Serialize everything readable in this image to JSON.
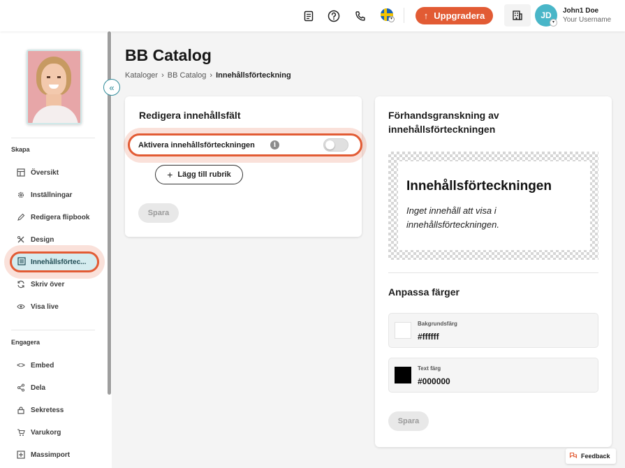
{
  "topbar": {
    "icons": [
      "document-icon",
      "help-icon",
      "phone-icon",
      "flag-sweden-icon"
    ],
    "upgrade_label": "Uppgradera",
    "avatar_initials": "JD",
    "user_name": "John1 Doe",
    "user_sub": "Your Username",
    "accent_color": "#e25b34"
  },
  "sidebar": {
    "section_create": "Skapa",
    "create_items": [
      {
        "label": "Översikt",
        "icon": "layout-icon"
      },
      {
        "label": "Inställningar",
        "icon": "gear-icon"
      },
      {
        "label": "Redigera flipbook",
        "icon": "pencil-icon"
      },
      {
        "label": "Design",
        "icon": "design-tools-icon"
      },
      {
        "label": "Innehållsförtec...",
        "icon": "list-icon",
        "active": true
      },
      {
        "label": "Skriv över",
        "icon": "refresh-icon"
      },
      {
        "label": "Visa live",
        "icon": "eye-icon"
      }
    ],
    "section_engage": "Engagera",
    "engage_items": [
      {
        "label": "Embed",
        "icon": "code-icon"
      },
      {
        "label": "Dela",
        "icon": "share-icon"
      },
      {
        "label": "Sekretess",
        "icon": "lock-icon"
      },
      {
        "label": "Varukorg",
        "icon": "cart-icon"
      },
      {
        "label": "Massimport",
        "icon": "import-icon"
      }
    ]
  },
  "main": {
    "title": "BB Catalog",
    "breadcrumb": [
      "Kataloger",
      "BB Catalog",
      "Innehållsförteckning"
    ],
    "edit_card": {
      "heading": "Redigera innehållsfält",
      "toggle_label": "Aktivera innehållsförteckningen",
      "toggle_on": false,
      "add_label": "Lägg till rubrik",
      "save_label": "Spara"
    },
    "preview_card": {
      "heading": "Förhandsgranskning av innehållsförteckningen",
      "preview_title": "Innehållsförteckningen",
      "preview_body": "Inget innehåll att visa i innehållsförteckningen.",
      "colors_heading": "Anpassa färger",
      "bg_label": "Bakgrundsfärg",
      "bg_value": "#ffffff",
      "text_label": "Text färg",
      "text_value": "#000000",
      "save_label": "Spara"
    }
  },
  "feedback_label": "Feedback"
}
